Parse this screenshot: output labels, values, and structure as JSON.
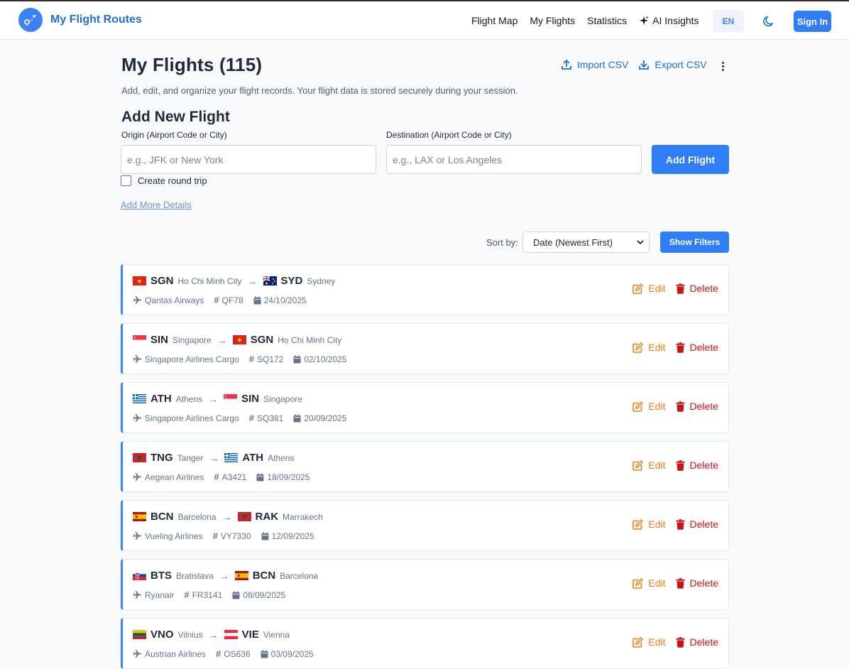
{
  "header": {
    "brand": "My Flight Routes",
    "nav": [
      {
        "label": "Flight Map"
      },
      {
        "label": "My Flights"
      },
      {
        "label": "Statistics"
      },
      {
        "label": "AI Insights",
        "icon": "sparkle-icon"
      }
    ],
    "lang": "EN",
    "signin": "Sign In"
  },
  "page": {
    "title": "My Flights (115)",
    "subtitle": "Add, edit, and organize your flight records. Your flight data is stored securely during your session.",
    "import_csv": "Import CSV",
    "export_csv": "Export CSV"
  },
  "add_form": {
    "title": "Add New Flight",
    "origin_label": "Origin (Airport Code or City)",
    "origin_placeholder": "e.g., JFK or New York",
    "destination_label": "Destination (Airport Code or City)",
    "destination_placeholder": "e.g., LAX or Los Angeles",
    "add_button": "Add Flight",
    "round_trip": "Create round trip",
    "more_details": "Add More Details"
  },
  "toolbar": {
    "sort_label": "Sort by:",
    "sort_value": "Date (Newest First)",
    "filters_button": "Show Filters"
  },
  "actions": {
    "edit": "Edit",
    "delete": "Delete"
  },
  "arrow": "→",
  "colors": {
    "accent": "#2f7ef5",
    "edit": "#f07d12",
    "delete": "#c81414"
  },
  "flights": [
    {
      "from_code": "SGN",
      "from_city": "Ho Chi Minh City",
      "from_flag": "VN",
      "to_code": "SYD",
      "to_city": "Sydney",
      "to_flag": "AU",
      "airline": "Qantas Airways",
      "flight_no": "QF78",
      "date": "24/10/2025"
    },
    {
      "from_code": "SIN",
      "from_city": "Singapore",
      "from_flag": "SG",
      "to_code": "SGN",
      "to_city": "Ho Chi Minh City",
      "to_flag": "VN",
      "airline": "Singapore Airlines Cargo",
      "flight_no": "SQ172",
      "date": "02/10/2025"
    },
    {
      "from_code": "ATH",
      "from_city": "Athens",
      "from_flag": "GR",
      "to_code": "SIN",
      "to_city": "Singapore",
      "to_flag": "SG",
      "airline": "Singapore Airlines Cargo",
      "flight_no": "SQ381",
      "date": "20/09/2025"
    },
    {
      "from_code": "TNG",
      "from_city": "Tanger",
      "from_flag": "MA",
      "to_code": "ATH",
      "to_city": "Athens",
      "to_flag": "GR",
      "airline": "Aegean Airlines",
      "flight_no": "A3421",
      "date": "18/09/2025"
    },
    {
      "from_code": "BCN",
      "from_city": "Barcelona",
      "from_flag": "ES",
      "to_code": "RAK",
      "to_city": "Marrakech",
      "to_flag": "MA",
      "airline": "Vueling Airlines",
      "flight_no": "VY7330",
      "date": "12/09/2025"
    },
    {
      "from_code": "BTS",
      "from_city": "Bratislava",
      "from_flag": "SK",
      "to_code": "BCN",
      "to_city": "Barcelona",
      "to_flag": "ES",
      "airline": "Ryanair",
      "flight_no": "FR3141",
      "date": "08/09/2025"
    },
    {
      "from_code": "VNO",
      "from_city": "Vilnius",
      "from_flag": "LT",
      "to_code": "VIE",
      "to_city": "Vienna",
      "to_flag": "AT",
      "airline": "Austrian Airlines",
      "flight_no": "OS636",
      "date": "03/09/2025"
    }
  ]
}
